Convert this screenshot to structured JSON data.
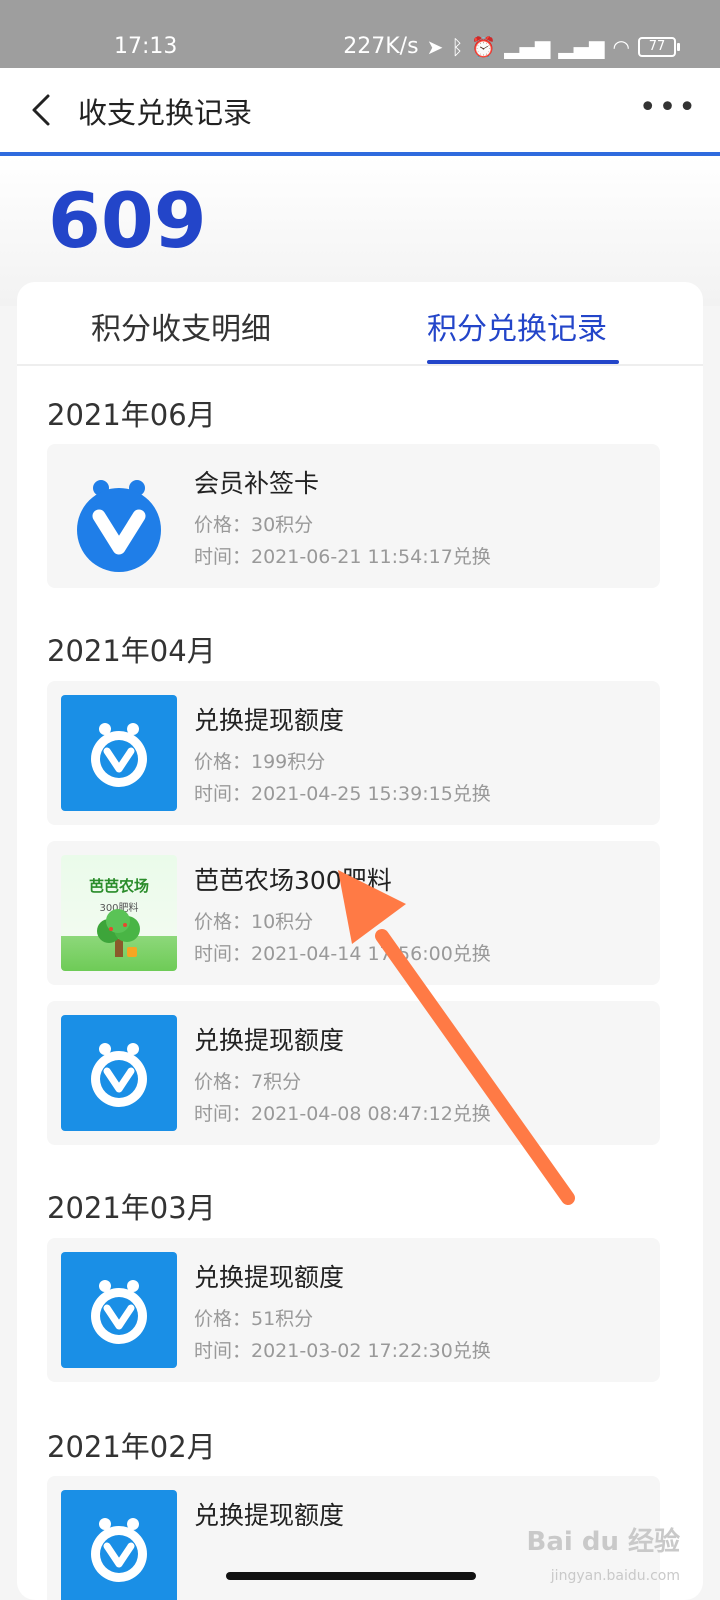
{
  "status_bar": {
    "time": "17:13",
    "net_speed": "227K/s",
    "battery": "77"
  },
  "header": {
    "title": "收支兑换记录"
  },
  "points": "609",
  "tabs": [
    {
      "label": "积分收支明细"
    },
    {
      "label": "积分兑换记录"
    }
  ],
  "months": [
    {
      "label": "2021年06月",
      "items": [
        {
          "name": "会员补签卡",
          "price": "价格：30积分",
          "time": "时间：2021-06-21 11:54:17兑换",
          "icon": "vip-card-icon"
        }
      ]
    },
    {
      "label": "2021年04月",
      "items": [
        {
          "name": "兑换提现额度",
          "price": "价格：199积分",
          "time": "时间：2021-04-25 15:39:15兑换",
          "icon": "cash-quota-icon"
        },
        {
          "name": "芭芭农场300肥料",
          "price": "价格：10积分",
          "time": "时间：2021-04-14 17:56:00兑换",
          "icon": "farm-fertilizer-thumb",
          "thumb_title": "芭芭农场",
          "thumb_sub": "300肥料"
        },
        {
          "name": "兑换提现额度",
          "price": "价格：7积分",
          "time": "时间：2021-04-08 08:47:12兑换",
          "icon": "cash-quota-icon"
        }
      ]
    },
    {
      "label": "2021年03月",
      "items": [
        {
          "name": "兑换提现额度",
          "price": "价格：51积分",
          "time": "时间：2021-03-02 17:22:30兑换",
          "icon": "cash-quota-icon"
        }
      ]
    },
    {
      "label": "2021年02月",
      "items": [
        {
          "name": "兑换提现额度",
          "icon": "cash-quota-icon"
        }
      ]
    }
  ],
  "watermark": {
    "text": "Bai du 经验",
    "sub": "jingyan.baidu.com"
  },
  "colors": {
    "accent": "#2345c9",
    "nav_line": "#2f6bde",
    "icon_blue": "#1a8fe6",
    "annotation_arrow": "#ff7a45"
  }
}
